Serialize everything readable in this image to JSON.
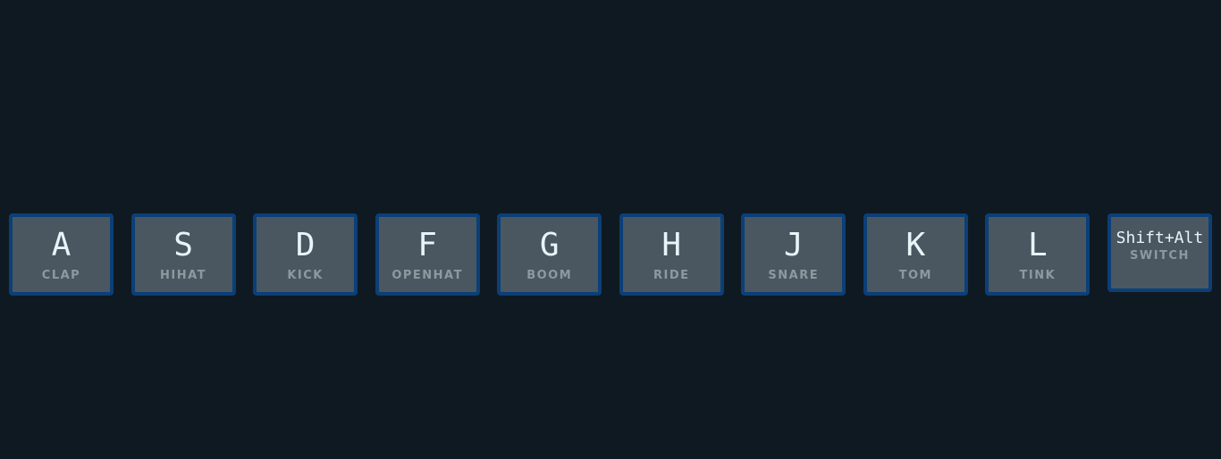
{
  "keys": [
    {
      "key": "A",
      "sound": "CLAP"
    },
    {
      "key": "S",
      "sound": "HIHAT"
    },
    {
      "key": "D",
      "sound": "KICK"
    },
    {
      "key": "F",
      "sound": "OPENHAT"
    },
    {
      "key": "G",
      "sound": "BOOM"
    },
    {
      "key": "H",
      "sound": "RIDE"
    },
    {
      "key": "J",
      "sound": "SNARE"
    },
    {
      "key": "K",
      "sound": "TOM"
    },
    {
      "key": "L",
      "sound": "TINK"
    },
    {
      "key": "Shift+Alt",
      "sound": "SWITCH"
    }
  ],
  "colors": {
    "background": "#0f1922",
    "key_fill": "#4a5760",
    "key_border": "#0b3f78",
    "key_letter": "#e8f4f8",
    "key_sound": "#8c9aa0"
  }
}
